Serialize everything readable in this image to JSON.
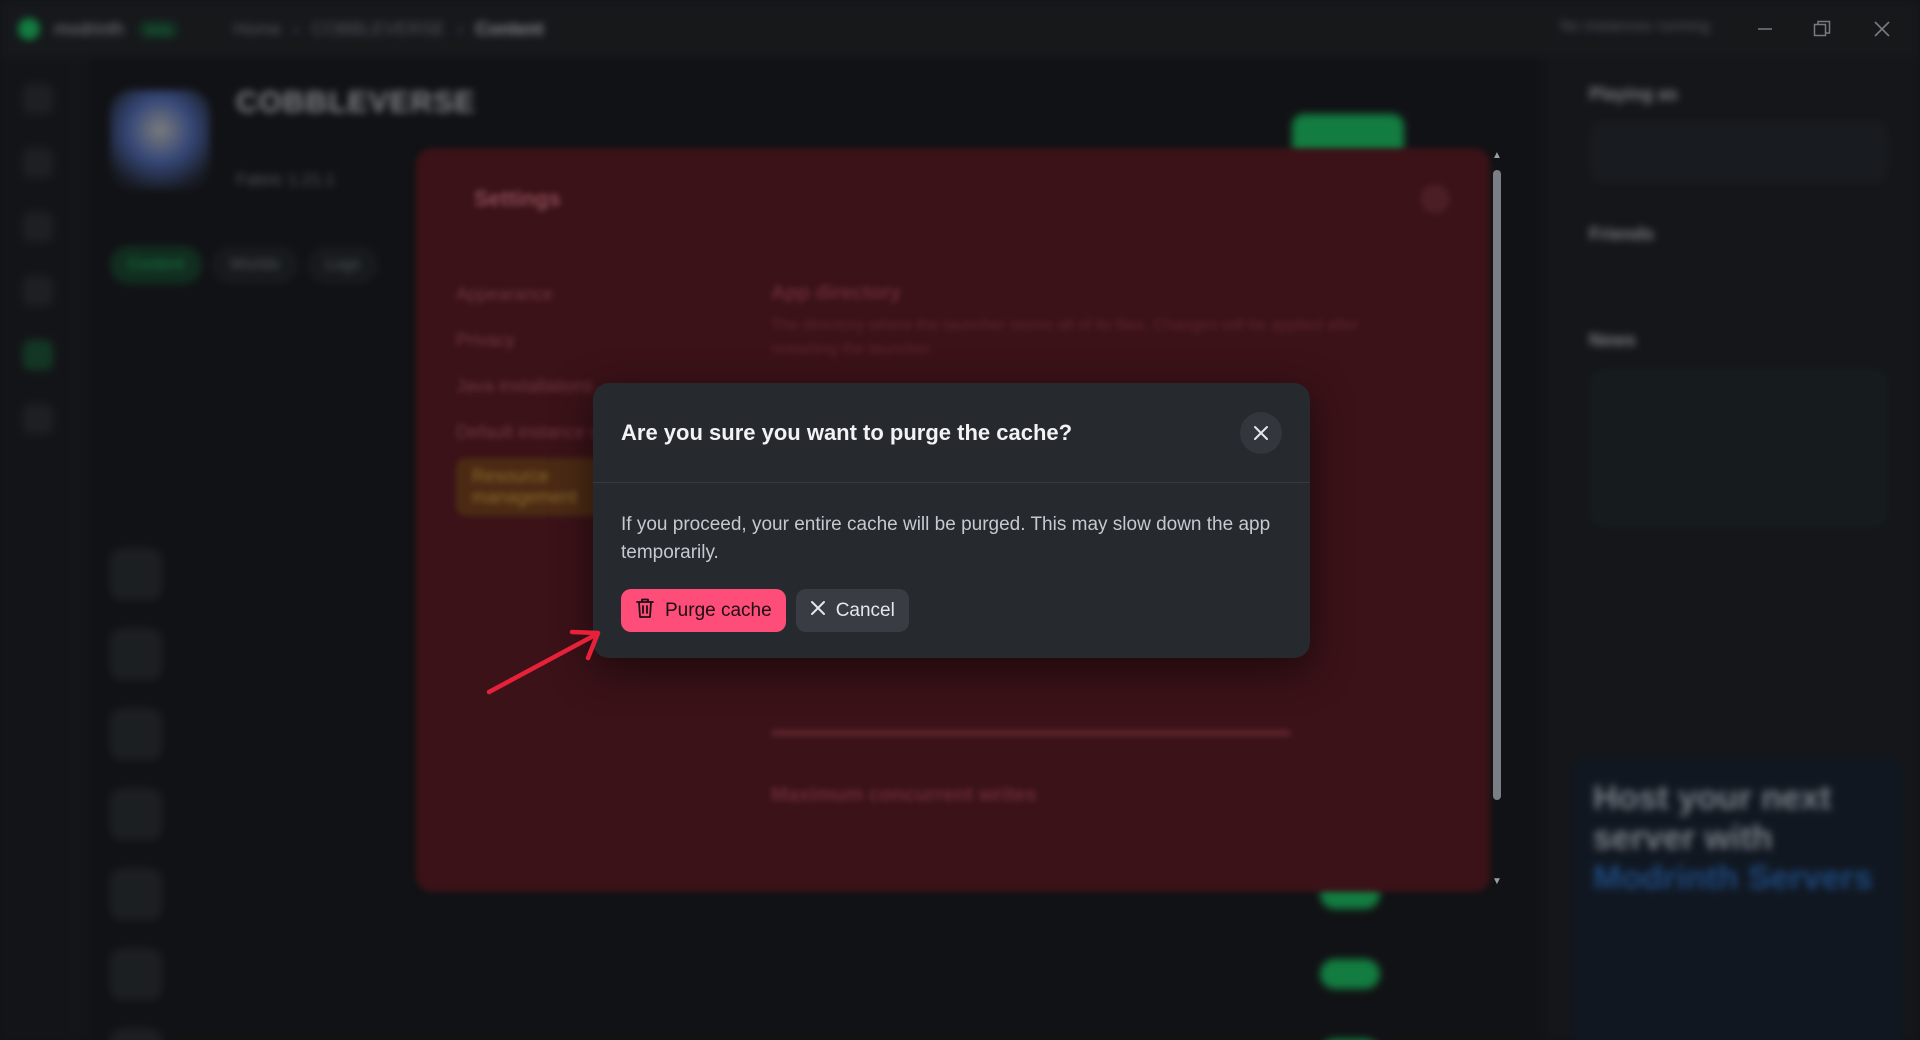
{
  "app": {
    "brand": "modrinth",
    "brand_badge": "beta",
    "breadcrumb": [
      "Home",
      "COBBLEVERSE",
      "Content"
    ],
    "status_text": "No instances running"
  },
  "window_controls": {
    "minimize_icon": "minimize-icon",
    "maximize_icon": "restore-icon",
    "close_icon": "close-icon"
  },
  "project": {
    "title": "COBBLEVERSE",
    "subtitle": "Fabric 1.21.1",
    "tabs": [
      "Content",
      "Worlds",
      "Logs"
    ]
  },
  "right_panel": {
    "playing_as": "Playing as",
    "friends": "Friends",
    "news": "News",
    "host_title_line1": "Host your next",
    "host_title_line2": "server with",
    "host_title_line3": "Modrinth Servers"
  },
  "settings": {
    "title": "Settings",
    "nav": [
      "Appearance",
      "Privacy",
      "Java installations",
      "Default instance options",
      "Resource management"
    ],
    "section_title": "App directory",
    "section_text": "The directory where the launcher stores all of its files. Changes will be applied after restarting the launcher.",
    "section2_title": "Maximum concurrent writes"
  },
  "dialog": {
    "title": "Are you sure you want to purge the cache?",
    "body": "If you proceed, your entire cache will be purged. This may slow down the app temporarily.",
    "confirm_label": "Purge cache",
    "cancel_label": "Cancel",
    "confirm_icon": "trash-icon",
    "cancel_icon": "close-icon",
    "close_icon": "close-icon"
  },
  "colors": {
    "danger": "#ff4d7a",
    "dialog_bg": "#26292e",
    "arrow": "#e8213a",
    "brand_green": "#1bd96a"
  }
}
